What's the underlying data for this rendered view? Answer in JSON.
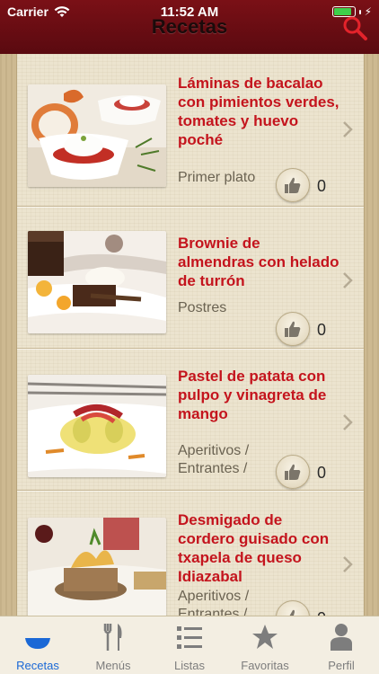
{
  "status_bar": {
    "carrier": "Carrier",
    "time": "11:52 AM"
  },
  "header": {
    "title": "Recetas"
  },
  "recipes": [
    {
      "title": "Láminas de bacalao con pimientos verdes, tomates y huevo poché",
      "category": "Primer plato",
      "likes": "0"
    },
    {
      "title": "Brownie de almendras con helado de turrón",
      "category": "Postres",
      "likes": "0"
    },
    {
      "title": "Pastel de patata con pulpo y vinagreta de mango",
      "category": "Aperitivos / Entrantes / Tapas",
      "likes": "0"
    },
    {
      "title": "Desmigado de cordero guisado con txapela de queso Idiazabal",
      "category": "Aperitivos / Entrantes / Tapas",
      "likes": "0"
    }
  ],
  "tabs": [
    {
      "label": "Recetas",
      "icon": "bowl-icon",
      "active": true
    },
    {
      "label": "Menús",
      "icon": "fork-knife-icon",
      "active": false
    },
    {
      "label": "Listas",
      "icon": "list-icon",
      "active": false
    },
    {
      "label": "Favoritas",
      "icon": "star-icon",
      "active": false
    },
    {
      "label": "Perfil",
      "icon": "person-icon",
      "active": false
    }
  ],
  "colors": {
    "header": "#6a0d13",
    "title_red": "#c4141d",
    "tab_active": "#1a68d6",
    "tab_inactive": "#7d7d7d"
  }
}
